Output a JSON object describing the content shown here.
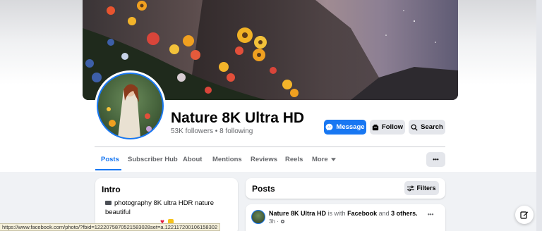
{
  "page": {
    "name": "Nature 8K Ultra HD",
    "followers_line": "53K followers • 8 following"
  },
  "actions": {
    "message": "Message",
    "follow": "Follow",
    "search": "Search"
  },
  "tabs": [
    {
      "label": "Posts",
      "active": true
    },
    {
      "label": "Subscriber Hub"
    },
    {
      "label": "About"
    },
    {
      "label": "Mentions"
    },
    {
      "label": "Reviews"
    },
    {
      "label": "Reels"
    },
    {
      "label": "More"
    }
  ],
  "more_menu_label": "•••",
  "intro": {
    "title": "Intro",
    "text": "photography 8K ultra HDR nature beautiful"
  },
  "posts": {
    "title": "Posts",
    "filters_label": "Filters"
  },
  "post": {
    "author": "Nature 8K Ultra HD",
    "is_with": "is with",
    "with_page": "Facebook",
    "and": "and",
    "others": "3 others.",
    "time": "3h ·",
    "menu": "•••"
  },
  "status_url": "https://www.facebook.com/photo/?fbid=1222075870521583028set=a.122117200106158302",
  "colors": {
    "accent": "#1877f2",
    "secondary_button": "#e4e6eb"
  }
}
